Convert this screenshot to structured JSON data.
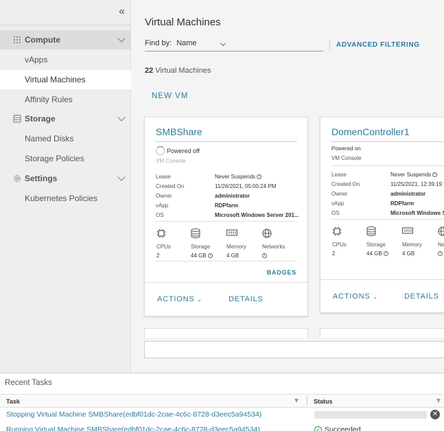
{
  "sidebar": {
    "collapse_glyph": "«",
    "groups": [
      {
        "label": "Compute",
        "icon": "grid-icon",
        "items": [
          "vApps",
          "Virtual Machines",
          "Affinity Rules"
        ]
      },
      {
        "label": "Storage",
        "icon": "database-icon",
        "items": [
          "Named Disks",
          "Storage Policies"
        ]
      },
      {
        "label": "Settings",
        "icon": "gear-icon",
        "items": [
          "Kubernetes Policies"
        ]
      }
    ],
    "active_item": "Virtual Machines"
  },
  "main": {
    "title": "Virtual Machines",
    "find_by_label": "Find by:",
    "find_by_value": "Name",
    "advanced_filtering": "ADVANCED FILTERING",
    "count": "22",
    "count_label": "Virtual Machines",
    "new_vm": "NEW VM"
  },
  "cards": [
    {
      "name": "SMBShare",
      "power_state": "Powered off",
      "console": "VM Console",
      "lease_label": "Lease",
      "lease": "Never Suspends",
      "created_label": "Created On",
      "created": "11/26/2021, 05:00:24 PM",
      "owner_label": "Owner",
      "owner": "administrator",
      "vapp_label": "vApp",
      "vapp": "RDPfarm",
      "os_label": "OS",
      "os": "Microsoft Windows Server 201...",
      "cpus_label": "CPUs",
      "cpus": "2",
      "storage_label": "Storage",
      "storage": "44 GB",
      "memory_label": "Memory",
      "memory": "4 GB",
      "networks_label": "Networks",
      "badges": "BADGES",
      "actions": "ACTIONS",
      "details": "DETAILS"
    },
    {
      "name": "DomenController1",
      "power_state": "Powered on",
      "console": "VM Console",
      "lease_label": "Lease",
      "lease": "Never Suspends",
      "created_label": "Created On",
      "created": "11/25/2021, 12:39:19 P",
      "owner_label": "Owner",
      "owner": "administrator",
      "vapp_label": "vApp",
      "vapp": "RDPfarm",
      "os_label": "OS",
      "os": "Microsoft Windows S",
      "cpus_label": "CPUs",
      "cpus": "2",
      "storage_label": "Storage",
      "storage": "44 GB",
      "memory_label": "Memory",
      "memory": "4 GB",
      "networks_label": "Ne",
      "actions": "ACTIONS",
      "details": "DETAILS"
    }
  ],
  "tasks": {
    "title": "Recent Tasks",
    "col_task": "Task",
    "col_status": "Status",
    "rows": [
      {
        "task": "Stopping Virtual Machine SMBShare(edbf01dc-2cae-4c6c-8728-d3eec5a94534)",
        "status": "",
        "progress": 0.0
      },
      {
        "task": "Running Virtual Machine SMBShare(edbf01dc-2cae-4c6c-8728-d3eec5a94534)",
        "status": "Succeeded"
      }
    ]
  },
  "colors": {
    "accent": "#2d7a9a",
    "sidebar_bg": "#eeeeee",
    "main_bg": "#f4f4f4"
  }
}
